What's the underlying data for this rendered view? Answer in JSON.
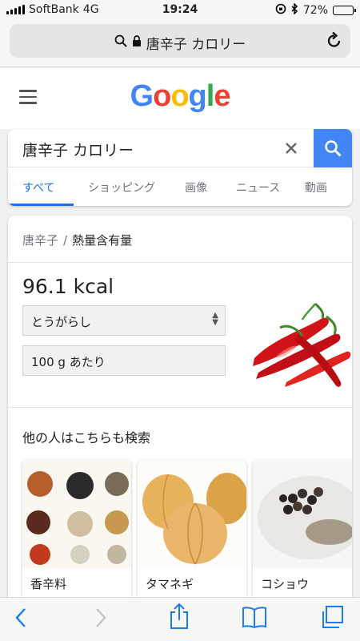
{
  "status_bar": {
    "carrier": "SoftBank",
    "network": "4G",
    "time": "19:24",
    "battery": "72%",
    "battery_level": 0.72,
    "icons": [
      "signal-icon",
      "orientation-lock-icon",
      "bluetooth-icon",
      "battery-icon"
    ]
  },
  "url_bar": {
    "text": "唐辛子 カロリー",
    "icons": [
      "search-icon",
      "lock-icon",
      "reload-icon"
    ]
  },
  "google_header": {
    "logo": "Google",
    "logo_colors": [
      "#4285f4",
      "#ea4335",
      "#fbbc05",
      "#4285f4",
      "#34a853",
      "#ea4335"
    ]
  },
  "search": {
    "query": "唐辛子 カロリー",
    "clear_icon": "close-icon",
    "button_icon": "search-icon",
    "tabs": [
      {
        "label": "すべて",
        "active": true
      },
      {
        "label": "ショッピング",
        "active": false
      },
      {
        "label": "画像",
        "active": false
      },
      {
        "label": "ニュース",
        "active": false
      },
      {
        "label": "動画",
        "active": false
      }
    ]
  },
  "knowledge": {
    "breadcrumb": {
      "parent": "唐辛子",
      "separator": "/",
      "current": "熱量含有量"
    },
    "calories": "96.1 kcal",
    "food_select": "とうがらし",
    "unit_select": "100 g あたり",
    "people_also_search": "他の人はこちらも検索",
    "related": [
      {
        "label": "香辛料"
      },
      {
        "label": "タマネギ"
      },
      {
        "label": "コショウ"
      }
    ]
  },
  "toolbar": {
    "icons": [
      "back-icon",
      "forward-icon",
      "share-icon",
      "bookmarks-icon",
      "tabs-icon"
    ]
  },
  "colors": {
    "accent": "#1a73e8",
    "search_button": "#4285f4"
  }
}
